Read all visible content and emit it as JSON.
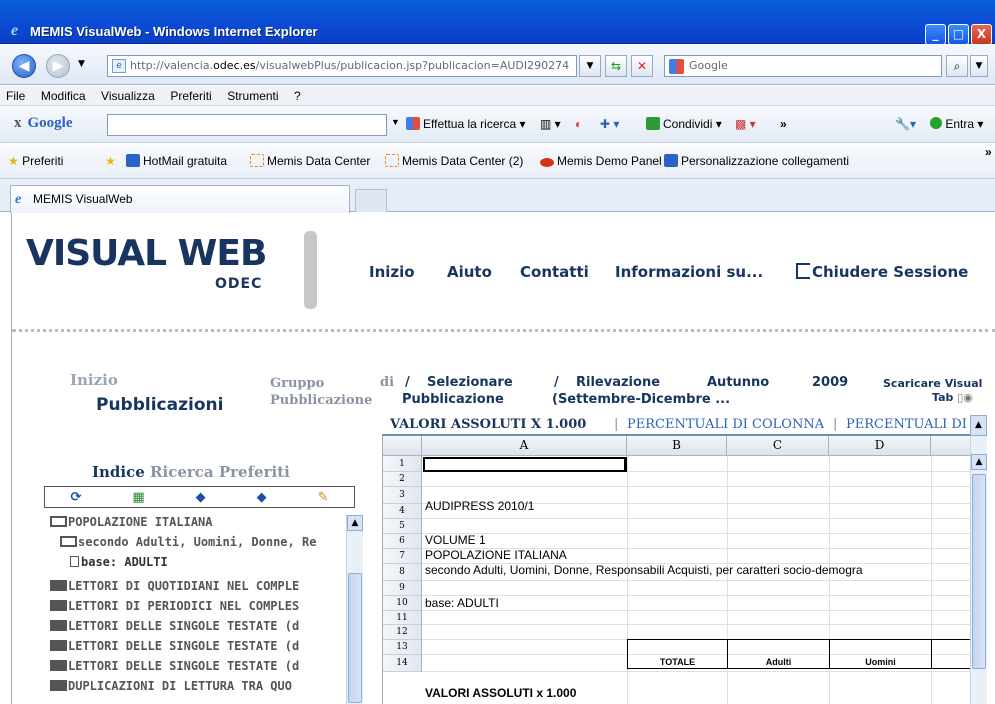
{
  "window": {
    "title": "MEMIS VisualWeb - Windows Internet Explorer",
    "min": "_",
    "max": "□",
    "close": "X"
  },
  "address": {
    "url_prefix": "http://valencia.",
    "url_host": "odec.es",
    "url_suffix": "/visualwebPlus/publicacion.jsp?publicacion=AUDI290274",
    "search_placeholder": "Google"
  },
  "menu": [
    "File",
    "Modifica",
    "Visualizza",
    "Preferiti",
    "Strumenti",
    "?"
  ],
  "google_bar": {
    "close": "x",
    "logo": "Google",
    "search_button": "Effettua la ricerca",
    "share": "Condividi",
    "more": "»",
    "signin": "Entra"
  },
  "favorites": {
    "label": "Preferiti",
    "items": [
      "HotMail gratuita",
      "Memis Data Center",
      "Memis Data Center (2)",
      "Memis Demo Panel",
      "Personalizzazione collegamenti"
    ],
    "more": "»"
  },
  "tab": {
    "label": "MEMIS VisualWeb"
  },
  "site": {
    "logo_main": "VISUAL WEB",
    "logo_sub": "ODEC",
    "nav": [
      "Inizio",
      "Aiuto",
      "Contatti",
      "Informazioni su...",
      "Chiudere Sessione"
    ],
    "breadcrumb": {
      "home": "Inizio",
      "current": "Pubblicazioni",
      "group_label": "Gruppo",
      "group_label2": "Pubblicazione",
      "di": "di",
      "sep": "/",
      "select": "Selezionare",
      "select2": "Pubblicazione",
      "rilev": "Rilevazione",
      "rilev2": "(Settembre-Dicembre ...",
      "season": "Autunno",
      "year": "2009",
      "download": "Scaricare Visual",
      "download2": "Tab"
    },
    "side_tabs": [
      "Indice",
      "Ricerca",
      "Preferiti"
    ],
    "tools": [
      "⟳",
      "▦",
      "◆",
      "◆",
      "✎"
    ],
    "tree": [
      {
        "text": "POPOLAZIONE ITALIANA",
        "icon": "folder-open"
      },
      {
        "text": "secondo Adulti, Uomini, Donne, Re",
        "icon": "folder-open"
      },
      {
        "text": "base: ADULTI",
        "icon": "document"
      },
      {
        "text": "LETTORI DI QUOTIDIANI NEL COMPLE",
        "icon": "folder"
      },
      {
        "text": "LETTORI DI PERIODICI NEL COMPLES",
        "icon": "folder"
      },
      {
        "text": "LETTORI DELLE SINGOLE TESTATE (d",
        "icon": "folder"
      },
      {
        "text": "LETTORI DELLE SINGOLE TESTATE (d",
        "icon": "folder"
      },
      {
        "text": "LETTORI DELLE SINGOLE TESTATE (d",
        "icon": "folder"
      },
      {
        "text": "DUPLICAZIONI DI LETTURA TRA QUO",
        "icon": "folder"
      }
    ]
  },
  "sheet": {
    "tabs": [
      "VALORI ASSOLUTI X 1.000",
      "PERCENTUALI DI COLONNA",
      "PERCENTUALI DI"
    ],
    "columns": [
      "A",
      "B",
      "C",
      "D"
    ],
    "rows": [
      "1",
      "2",
      "3",
      "4",
      "5",
      "6",
      "7",
      "8",
      "9",
      "10",
      "11",
      "12",
      "13",
      "14"
    ],
    "cells": {
      "r3": "AUDIPRESS 2010/1",
      "r5": "VOLUME 1",
      "r6": "POPOLAZIONE ITALIANA",
      "r7": "secondo Adulti, Uomini, Donne, Responsabili Acquisti, per caratteri socio-demogra",
      "r9": "base: ADULTI",
      "r14": "VALORI ASSOLUTI x 1.000"
    },
    "headers": [
      "TOTALE",
      "Adulti",
      "Uomini"
    ]
  }
}
